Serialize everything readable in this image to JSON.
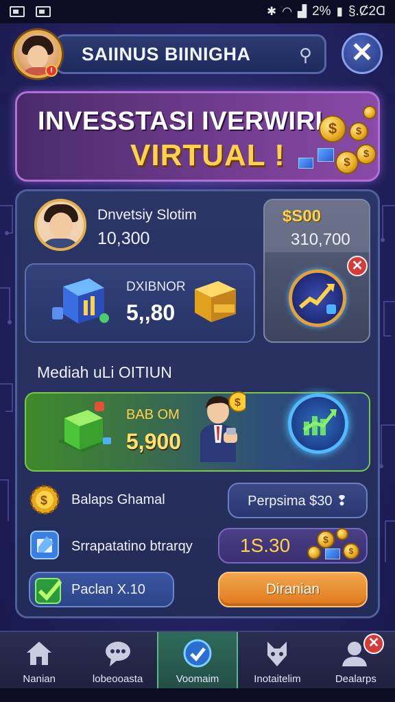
{
  "status_bar": {
    "battery": "2%",
    "time": "§.Ȼ2Ɑ",
    "icons": [
      "gallery-icon",
      "image-icon",
      "mute-icon",
      "wifi-icon",
      "signal-icon",
      "battery-icon"
    ]
  },
  "header": {
    "player_name": "SAIINUS BIINIGHA",
    "pin_icon": "pin-icon",
    "close_label": "✕"
  },
  "banner": {
    "line1": "INVESSTASI IVERWIRI",
    "line2": "VIRTUAL  !"
  },
  "profile": {
    "name": "Dnvetsiy Slotim",
    "value": "10,300"
  },
  "right_card": {
    "price": "$S00",
    "value": "310,700",
    "close_label": "✕"
  },
  "d_box": {
    "label": "DXIBNOR",
    "value": "5,,80"
  },
  "section": {
    "title": "Mediah uLi OITIUN"
  },
  "green_card": {
    "label": "BAB OM",
    "value": "5,900"
  },
  "rows": {
    "balance_label": "Balaps Ghamal",
    "balance_pill": "Perpsima $30 ❢",
    "strategy_label": "Srrapatatino btrarqy",
    "strategy_value": "1S.30",
    "check_pill": "Paclan X.10",
    "action_button": "Diranian"
  },
  "nav": [
    {
      "label": "Nanian",
      "icon": "home-icon"
    },
    {
      "label": "lobeooasta",
      "icon": "chat-icon"
    },
    {
      "label": "Voomaim",
      "icon": "check-circle-icon",
      "active": true
    },
    {
      "label": "Inotaitelim",
      "icon": "fox-icon"
    },
    {
      "label": "Dealarps",
      "icon": "user-icon",
      "badge": "✕"
    }
  ],
  "colors": {
    "gold": "#ffd24a",
    "accent_purple": "#b46fd6",
    "accent_green": "#78c84a",
    "orange": "#e0781e",
    "alert_red": "#d83a3a"
  }
}
